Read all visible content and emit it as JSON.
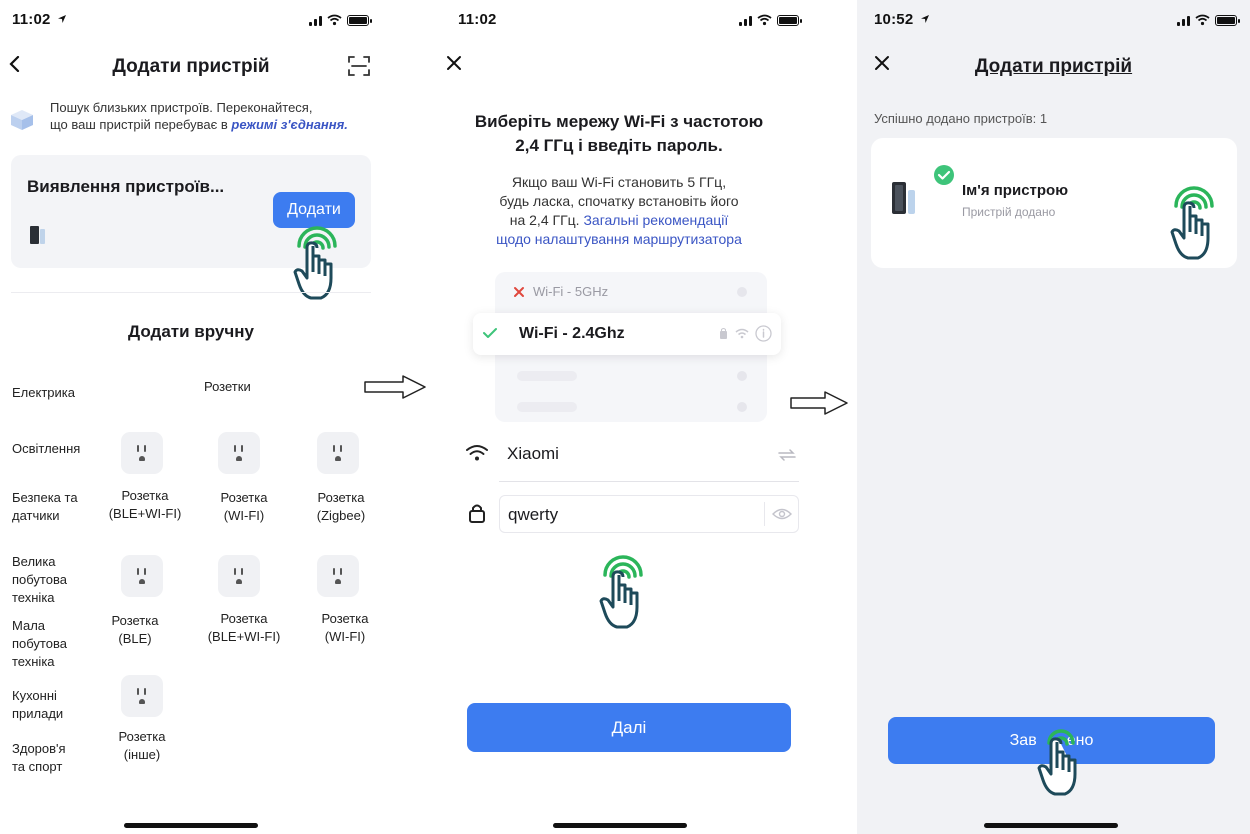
{
  "screen1": {
    "status_time": "11:02",
    "title": "Додати пристрій",
    "search_text_line1": "Пошук близьких пристроїв. Переконайтеся,",
    "search_text_line2": "що ваш пристрій перебуває в",
    "pairing_link": "режимі з'єднання.",
    "detecting_label": "Виявлення пристроїв...",
    "add_button": "Додати",
    "manual_title": "Додати вручну",
    "selected_category": "Розетки",
    "categories": [
      {
        "l1": "Електрика",
        "l2": "",
        "l3": ""
      },
      {
        "l1": "Освітлення",
        "l2": "",
        "l3": ""
      },
      {
        "l1": "Безпека та",
        "l2": "датчики",
        "l3": ""
      },
      {
        "l1": "Велика",
        "l2": "побутова",
        "l3": "техніка"
      },
      {
        "l1": "Мала",
        "l2": "побутова",
        "l3": "техніка"
      },
      {
        "l1": "Кухонні",
        "l2": "прилади",
        "l3": ""
      },
      {
        "l1": "Здоров'я",
        "l2": "та спорт",
        "l3": ""
      }
    ],
    "devices": [
      {
        "l1": "Розетка",
        "l2": "(BLE+WI-FI)"
      },
      {
        "l1": "Розетка",
        "l2": "(WI-FI)"
      },
      {
        "l1": "Розетка",
        "l2": "(Zigbee)"
      },
      {
        "l1": "Розетка",
        "l2": "(BLE)"
      },
      {
        "l1": "Розетка",
        "l2": "(BLE+WI-FI)"
      },
      {
        "l1": "Розетка",
        "l2": "(WI-FI)"
      },
      {
        "l1": "Розетка",
        "l2": "(інше)"
      }
    ]
  },
  "screen2": {
    "status_time": "11:02",
    "heading_line1": "Виберіть мережу Wi-Fi з частотою",
    "heading_line2": "2,4 ГГц і введіть пароль.",
    "hint_line1": "Якщо ваш Wi-Fi становить 5 ГГц,",
    "hint_line2": "будь ласка, спочатку встановіть його",
    "hint_line3_prefix": "на 2,4 ГГц.",
    "hint_link_part1": "Загальні рекомендації",
    "hint_link_part2": "щодо налаштування маршрутизатора",
    "network_5g": "Wi-Fi - 5GHz",
    "network_24g": "Wi-Fi - 2.4Ghz",
    "ssid_value": "Xiaomi",
    "password_value": "qwerty",
    "next_button": "Далі"
  },
  "screen3": {
    "status_time": "10:52",
    "title": "Додати пристрій",
    "success_count_label": "Успішно додано пристроїв: 1",
    "device_name": "Ім'я пристрою",
    "device_status": "Пристрій додано",
    "done_button_left": "Зав",
    "done_button_right": "ено"
  },
  "colors": {
    "accent_blue": "#3d7cf0",
    "link_blue": "#3a55c4",
    "tap_green": "#2bb55a",
    "success_green": "#3ec47a",
    "error_red": "#e0483e"
  }
}
